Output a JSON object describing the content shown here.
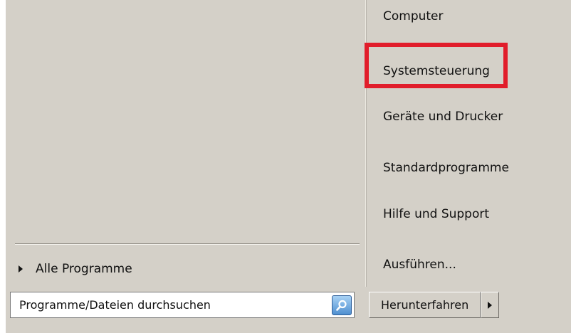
{
  "right_pane": {
    "items": [
      {
        "label": "Computer"
      },
      {
        "label": "Systemsteuerung",
        "highlighted": true
      },
      {
        "label": "Geräte und Drucker"
      },
      {
        "label": "Standardprogramme"
      },
      {
        "label": "Hilfe und Support"
      },
      {
        "label": "Ausführen..."
      }
    ]
  },
  "left_pane": {
    "all_programs_label": "Alle Programme"
  },
  "search": {
    "placeholder": "Programme/Dateien durchsuchen",
    "icon": "search-icon"
  },
  "shutdown": {
    "label": "Herunterfahren",
    "arrow_icon": "arrow-right-icon"
  },
  "colors": {
    "highlight_border": "#e11d2b",
    "menu_background": "#d4d0c8"
  }
}
